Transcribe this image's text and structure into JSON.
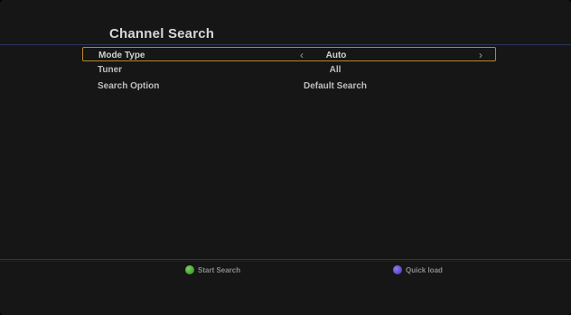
{
  "screen": {
    "title": "Channel Search"
  },
  "options": [
    {
      "label": "Mode Type",
      "value": "Auto",
      "selected": true
    },
    {
      "label": "Tuner",
      "value": "All",
      "selected": false
    },
    {
      "label": "Search Option",
      "value": "Default Search",
      "selected": false
    }
  ],
  "arrows": {
    "left": "‹",
    "right": "›"
  },
  "footer": {
    "green_label": "Start Search",
    "purple_label": "Quick load"
  },
  "colors": {
    "selection_border": "#b8862a",
    "green_key": "#2e8a1f",
    "purple_key": "#4331b8"
  },
  "icons": {
    "green": "green-button-icon",
    "purple": "purple-button-icon"
  }
}
